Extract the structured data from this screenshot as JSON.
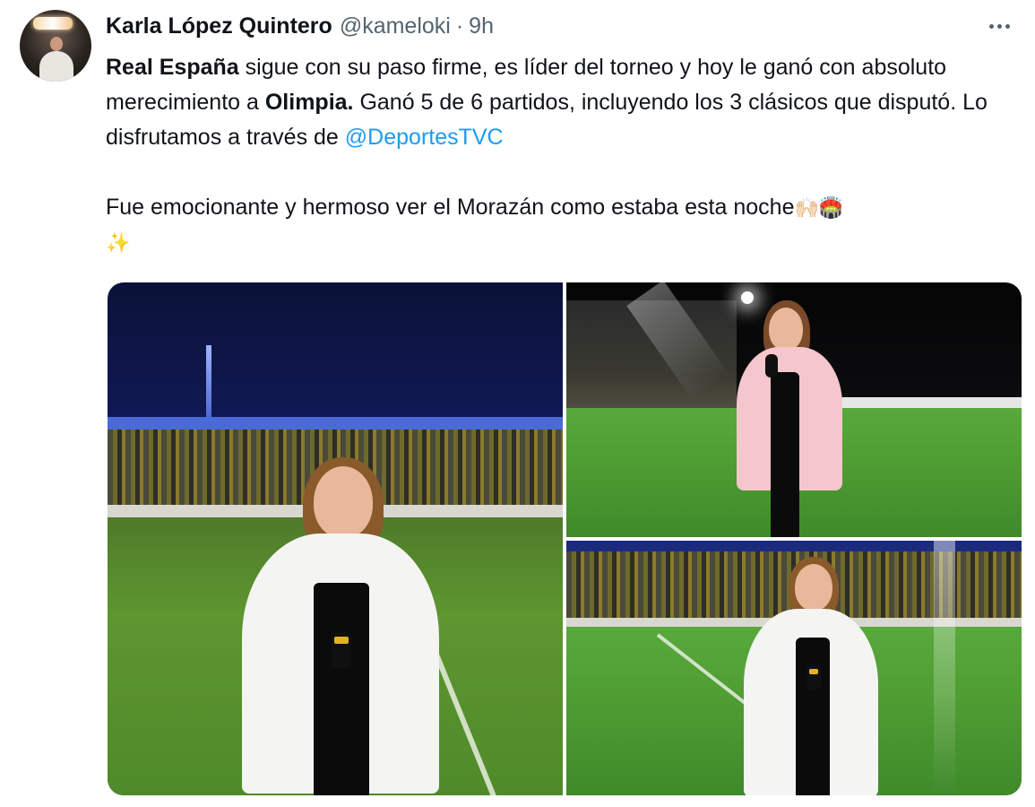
{
  "tweet": {
    "author": {
      "display_name": "Karla López Quintero",
      "handle": "@kameloki",
      "separator": "·",
      "time": "9h"
    },
    "text": {
      "line1": {
        "b1": "Real España",
        "t1": " sigue con su paso firme, es líder del torneo y hoy le ganó con absoluto merecimiento a ",
        "b2": "Olimpia.",
        "t2": " Ganó 5 de 6 partidos, incluyendo los 3 clásicos que disputó. Lo disfrutamos a través de ",
        "mention": "@DeportesTVC"
      },
      "line2": {
        "t1": "Fue emocionante y hermoso ver el Morazán como estaba esta noche",
        "emoji1": "🙌🏻",
        "emoji2": "🏟️",
        "emoji3": "✨"
      }
    },
    "icons": {
      "more": "more-options-icon",
      "avatar": "avatar"
    },
    "colors": {
      "link": "#1d9bf0",
      "secondary_text": "#536471",
      "primary_text": "#0f1419"
    },
    "media": {
      "count": 3
    }
  }
}
